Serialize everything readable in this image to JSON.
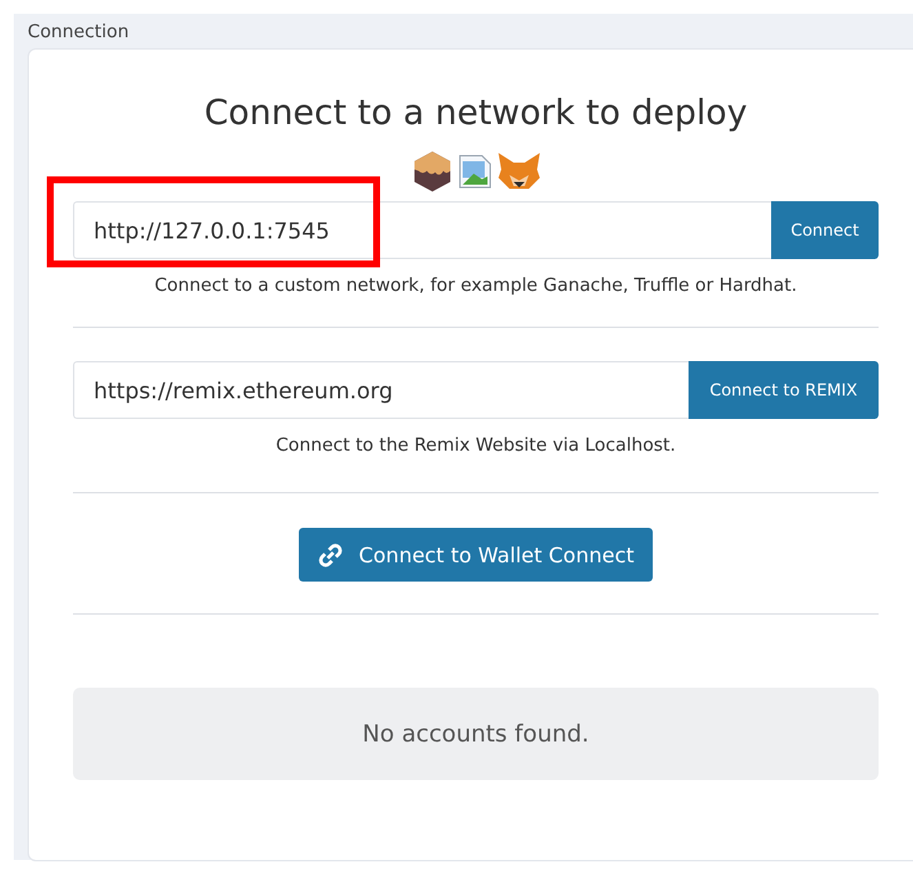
{
  "panel": {
    "title": "Connection"
  },
  "heading": "Connect to a network to deploy",
  "custom": {
    "value": "http://127.0.0.1:7545",
    "button": "Connect",
    "hint": "Connect to a custom network, for example Ganache, Truffle or Hardhat.",
    "highlighted": true
  },
  "remix": {
    "value": "https://remix.ethereum.org",
    "button": "Connect to REMIX",
    "hint": "Connect to the Remix Website via Localhost."
  },
  "wallet_button": "Connect to Wallet Connect",
  "accounts": {
    "message": "No accounts found."
  }
}
